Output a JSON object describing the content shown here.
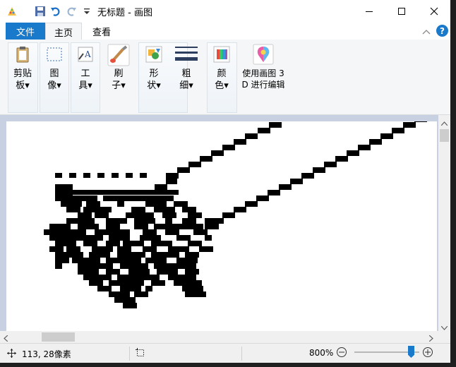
{
  "window": {
    "title": "无标题 - 画图"
  },
  "titlebar": {
    "icons": [
      "paint-app-icon",
      "save-icon",
      "undo-icon",
      "redo-icon",
      "customize-qa-icon"
    ],
    "controls": [
      "minimize-icon",
      "maximize-icon",
      "close-icon"
    ]
  },
  "tabs": {
    "file": "文件",
    "home": "主页",
    "view": "查看"
  },
  "ribbon": {
    "clipboard": "剪贴\n板▾",
    "image": "图\n像▾",
    "tools": "工\n具▾",
    "brushes": "刷\n子▾",
    "shapes": "形\n状▾",
    "size": "粗\n细▾",
    "colors": "颜\n色▾",
    "paint3d": "使用画图 3\nD 进行编辑"
  },
  "status": {
    "cursor_position": "113, 28像素",
    "zoom_level": "800%"
  },
  "colors": {
    "accent": "#1979ca",
    "help": "#1979ca",
    "canvas_bg": "#c8d1e2"
  }
}
